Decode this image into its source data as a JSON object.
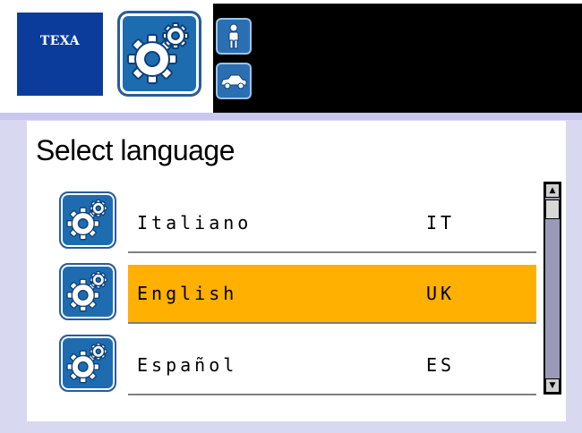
{
  "header": {
    "logo_text": "TEXA",
    "app_icon": "gears-icon",
    "person_button_icon": "person-icon",
    "car_button_icon": "car-icon"
  },
  "main": {
    "title": "Select language",
    "languages": [
      {
        "name": "Italiano",
        "code": "IT",
        "selected": false,
        "icon": "gears-icon"
      },
      {
        "name": "English",
        "code": "UK",
        "selected": true,
        "icon": "gears-icon"
      },
      {
        "name": "Español",
        "code": "ES",
        "selected": false,
        "icon": "gears-icon"
      }
    ]
  },
  "scrollbar": {
    "up_icon": "arrow-up-icon",
    "down_icon": "arrow-down-icon"
  },
  "colors": {
    "selection": "#ffb000",
    "brand_blue": "#0b3c9c",
    "icon_blue": "#1e6cb0"
  }
}
